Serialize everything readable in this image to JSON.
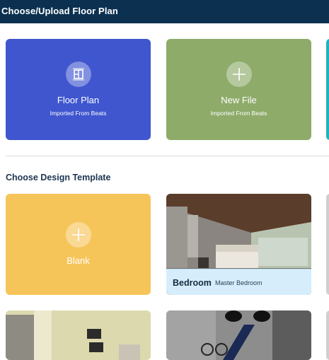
{
  "header": {
    "title": "Choose/Upload Floor Plan"
  },
  "upload_cards": [
    {
      "title": "Floor Plan",
      "subtitle": "Imported From Beats",
      "icon": "floor-plan-icon",
      "color": "#3f56cf"
    },
    {
      "title": "New File",
      "subtitle": "Imported From Beats",
      "icon": "plus-icon",
      "color": "#8eab6a"
    }
  ],
  "design_section": {
    "title": "Choose Design Template"
  },
  "templates": [
    {
      "title": "Blank",
      "icon": "plus-icon",
      "color": "#f6c55a"
    },
    {
      "title": "Bedroom",
      "subtitle": "Master Bedroom"
    }
  ],
  "colors": {
    "header_bg": "#0c3150",
    "accent_teal": "#1fb3bf",
    "label_strip": "#d6eefc"
  }
}
